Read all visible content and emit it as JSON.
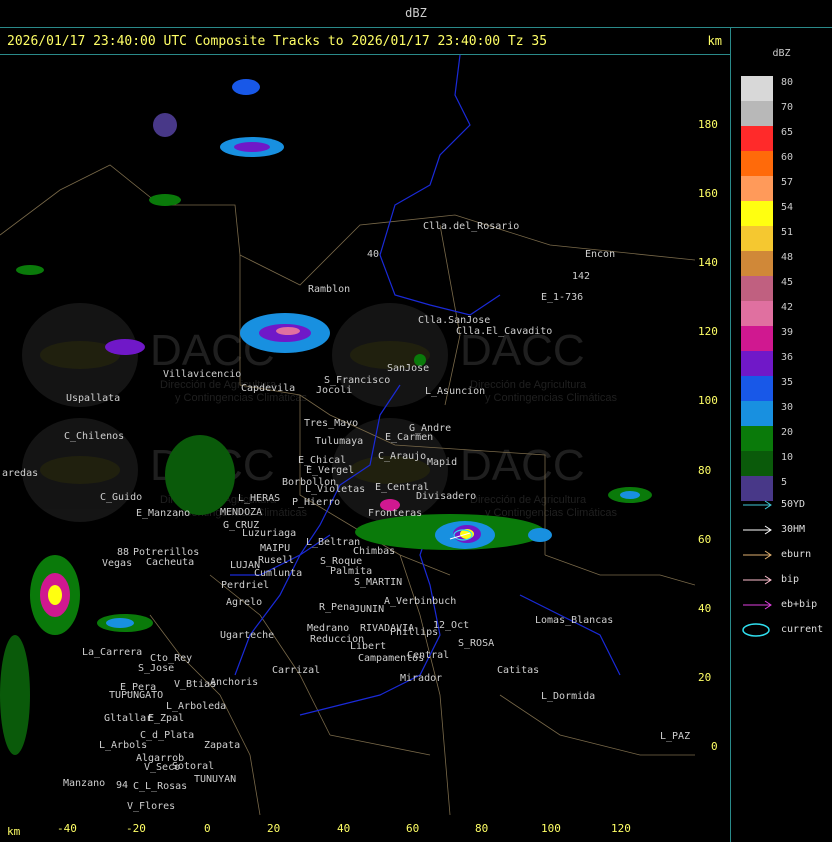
{
  "window": {
    "title": "dBZ"
  },
  "header": {
    "title": "2026/01/17 23:40:00 UTC Composite Tracks to 2026/01/17 23:40:00 Tz 35",
    "unit_top": "km"
  },
  "axes": {
    "y_ticks": [
      "180",
      "160",
      "140",
      "120",
      "100",
      "80",
      "60",
      "40",
      "20",
      "0"
    ],
    "x_ticks": [
      "-40",
      "-20",
      "0",
      "20",
      "40",
      "60",
      "80",
      "100",
      "120"
    ],
    "x_unit": "km"
  },
  "legend": {
    "title": "dBZ",
    "levels": [
      {
        "label": "80",
        "color": "#d8d8d8"
      },
      {
        "label": "70",
        "color": "#b8b8b8"
      },
      {
        "label": "65",
        "color": "#ff2a2a"
      },
      {
        "label": "60",
        "color": "#ff6a0a"
      },
      {
        "label": "57",
        "color": "#ff9a5a"
      },
      {
        "label": "54",
        "color": "#ffff10"
      },
      {
        "label": "51",
        "color": "#f5c830"
      },
      {
        "label": "48",
        "color": "#d08838"
      },
      {
        "label": "45",
        "color": "#c06080"
      },
      {
        "label": "42",
        "color": "#e070a0"
      },
      {
        "label": "39",
        "color": "#d01890"
      },
      {
        "label": "36",
        "color": "#7018c8"
      },
      {
        "label": "35",
        "color": "#1858e8"
      },
      {
        "label": "30",
        "color": "#1890e0"
      },
      {
        "label": "20",
        "color": "#0a7a0a"
      },
      {
        "label": "10",
        "color": "#0a5a0a"
      },
      {
        "label": "5",
        "color": "#483888"
      }
    ],
    "tracks": [
      {
        "label": "50YD",
        "color": "#40c8d8"
      },
      {
        "label": "30HM",
        "color": "#ffffff"
      },
      {
        "label": "eburn",
        "color": "#e0b070"
      },
      {
        "label": "bip",
        "color": "#ffc0d0"
      },
      {
        "label": "eb+bip",
        "color": "#e040e0"
      },
      {
        "label": "current",
        "color": "#30e0f0"
      }
    ]
  },
  "watermark": {
    "brand": "DACC",
    "line1": "Dirección de Agricultura",
    "line2": "y Contingencias Climáticas"
  },
  "places": [
    {
      "name": "Clla.del_Rosario"
    },
    {
      "name": "Encon"
    },
    {
      "name": "E_1-736"
    },
    {
      "name": "142"
    },
    {
      "name": "Ramblon"
    },
    {
      "name": "Clla.SanJose"
    },
    {
      "name": "Clla.El_Cavadito"
    },
    {
      "name": "Villavicencio"
    },
    {
      "name": "Capdevila"
    },
    {
      "name": "S_Francisco"
    },
    {
      "name": "Jocoli"
    },
    {
      "name": "SanJose"
    },
    {
      "name": "L_Asuncion"
    },
    {
      "name": "Uspallata"
    },
    {
      "name": "Tres_Mayo"
    },
    {
      "name": "Tulumaya"
    },
    {
      "name": "G_Andre"
    },
    {
      "name": "E_Carmen"
    },
    {
      "name": "C_Chilenos"
    },
    {
      "name": "E_Chical"
    },
    {
      "name": "E_Vergel"
    },
    {
      "name": "C_Araujo"
    },
    {
      "name": "Mapid"
    },
    {
      "name": "aredas"
    },
    {
      "name": "Borbollon"
    },
    {
      "name": "L_Violetas"
    },
    {
      "name": "C_Guido"
    },
    {
      "name": "L_HERAS"
    },
    {
      "name": "P_Hierro"
    },
    {
      "name": "E_Central"
    },
    {
      "name": "Divisadero"
    },
    {
      "name": "E_Manzano"
    },
    {
      "name": "MENDOZA"
    },
    {
      "name": "G_CRUZ"
    },
    {
      "name": "Fronteras"
    },
    {
      "name": "Luzuriaga"
    },
    {
      "name": "L_Beltran"
    },
    {
      "name": "Chimbas"
    },
    {
      "name": "Rusell"
    },
    {
      "name": "S_Roque"
    },
    {
      "name": "MAIPU"
    },
    {
      "name": "LUJAN"
    },
    {
      "name": "Cumlunta"
    },
    {
      "name": "Palmita"
    },
    {
      "name": "Potrerillos"
    },
    {
      "name": "Cacheuta"
    },
    {
      "name": "Vegas"
    },
    {
      "name": "Perdriel"
    },
    {
      "name": "S_MARTIN"
    },
    {
      "name": "Agrelo"
    },
    {
      "name": "A_Verbinbuch"
    },
    {
      "name": "R_Pena"
    },
    {
      "name": "JUNIN"
    },
    {
      "name": "Ugarteche"
    },
    {
      "name": "Medrano"
    },
    {
      "name": "RIVADAVIA"
    },
    {
      "name": "12_Oct"
    },
    {
      "name": "Phillips"
    },
    {
      "name": "Lomas_Blancas"
    },
    {
      "name": "Reduccion"
    },
    {
      "name": "Libert"
    },
    {
      "name": "S_ROSA"
    },
    {
      "name": "Central"
    },
    {
      "name": "La_Carrera"
    },
    {
      "name": "Cto_Rey"
    },
    {
      "name": "S_Jose"
    },
    {
      "name": "Carrizal"
    },
    {
      "name": "Campamentos"
    },
    {
      "name": "Catitas"
    },
    {
      "name": "E_Pera"
    },
    {
      "name": "V_Btias"
    },
    {
      "name": "Anchoris"
    },
    {
      "name": "Mirador"
    },
    {
      "name": "TUPUNGATO"
    },
    {
      "name": "L_Arboleda"
    },
    {
      "name": "L_Dormida"
    },
    {
      "name": "Gltallar"
    },
    {
      "name": "E_Zpal"
    },
    {
      "name": "L_Arbols"
    },
    {
      "name": "C_d_Plata"
    },
    {
      "name": "Zapata"
    },
    {
      "name": "L_PAZ"
    },
    {
      "name": "Algarrob"
    },
    {
      "name": "V_Seco"
    },
    {
      "name": "Sotoral"
    },
    {
      "name": "Manzano"
    },
    {
      "name": "C_L_Rosas"
    },
    {
      "name": "TUNUYAN"
    },
    {
      "name": "V_Flores"
    },
    {
      "name": "88"
    },
    {
      "name": "40"
    },
    {
      "name": "94"
    }
  ]
}
